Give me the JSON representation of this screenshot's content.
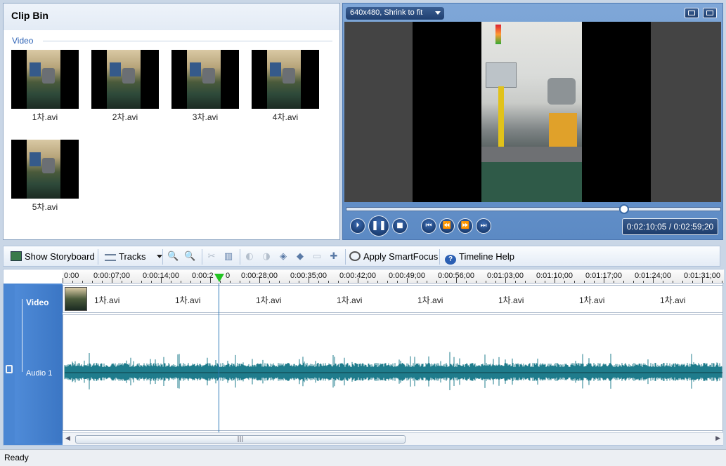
{
  "clip_bin": {
    "title": "Clip Bin",
    "group_label": "Video",
    "clips": [
      {
        "name": "1차.avi"
      },
      {
        "name": "2차.avi"
      },
      {
        "name": "3차.avi"
      },
      {
        "name": "4차.avi"
      },
      {
        "name": "5차.avi"
      }
    ]
  },
  "preview": {
    "resolution_label": "640x480, Shrink to fit",
    "seek_fraction": 0.74,
    "timecode": "0:02:10;05 / 0:02:59;20",
    "controls": {
      "play_frame": "⏵",
      "pause": "❚❚",
      "stop": "■",
      "prev": "⏮",
      "rewind": "⏪",
      "forward": "⏩",
      "next": "⏭"
    }
  },
  "toolbar": {
    "show_storyboard": "Show Storyboard",
    "tracks": "Tracks",
    "apply_smartfocus": "Apply SmartFocus",
    "timeline_help": "Timeline Help"
  },
  "timeline": {
    "ruler_ticks": [
      "0:00",
      "0:00:07;00",
      "0:00:14;00",
      "0:00:2",
      "0",
      "0:00:28;00",
      "0:00:35;00",
      "0:00:42;00",
      "0:00:49;00",
      "0:00:56;00",
      "0:01:03;00",
      "0:01:10;00",
      "0:01:17;00",
      "0:01:24;00",
      "0:01:31;00"
    ],
    "video_track_label": "Video",
    "audio_track_label": "Audio 1",
    "video_clip_labels": [
      "1차.avi",
      "1차.avi",
      "1차.avi",
      "1차.avi",
      "1차.avi",
      "1차.avi",
      "1차.avi",
      "1차.avi"
    ],
    "waveform_color": "#1f7c8c",
    "scroll_grip": "|||"
  },
  "status": {
    "text": "Ready"
  }
}
